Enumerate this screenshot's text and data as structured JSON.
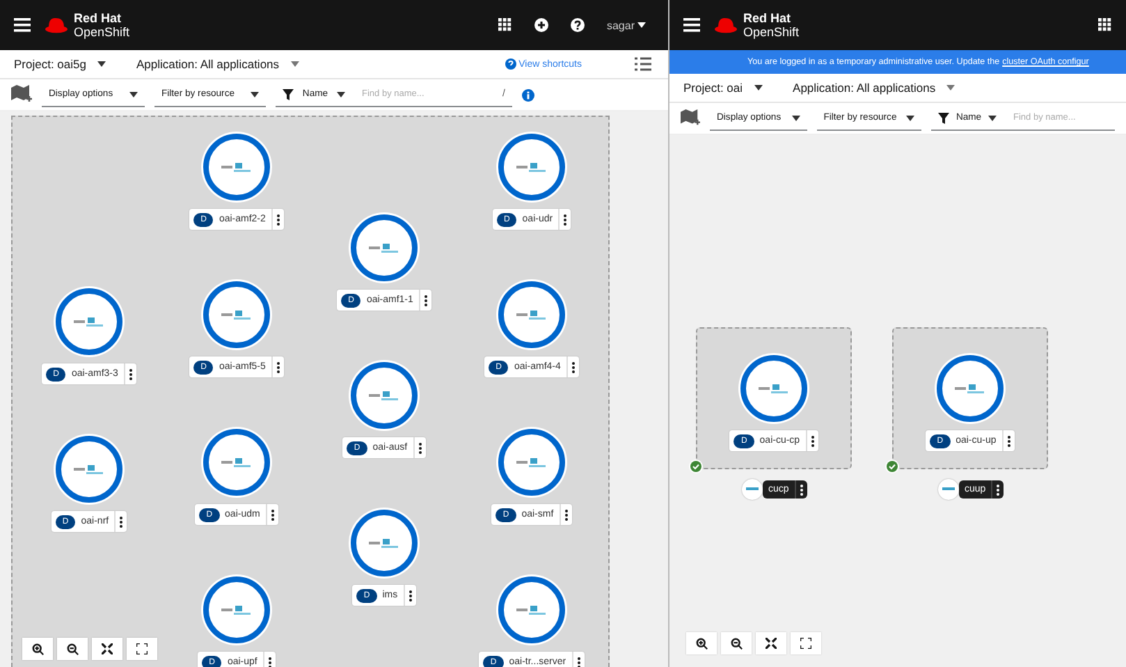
{
  "left_pane": {
    "header": {
      "brand_top": "Red Hat",
      "brand_bottom": "OpenShift",
      "user": "sagar"
    },
    "project_bar": {
      "project": "Project: oai5g",
      "application": "Application: All applications",
      "shortcuts": "View shortcuts"
    },
    "toolbar": {
      "display": "Display options",
      "filter": "Filter by resource",
      "name_filter": "Name",
      "search_placeholder": "Find by name...",
      "shortcut_key": "/"
    },
    "nodes": [
      {
        "badge": "D",
        "name": "oai-amf2-2"
      },
      {
        "badge": "D",
        "name": "oai-udr"
      },
      {
        "badge": "D",
        "name": "oai-amf1-1"
      },
      {
        "badge": "D",
        "name": "oai-amf3-3"
      },
      {
        "badge": "D",
        "name": "oai-amf5-5"
      },
      {
        "badge": "D",
        "name": "oai-amf4-4"
      },
      {
        "badge": "D",
        "name": "oai-ausf"
      },
      {
        "badge": "D",
        "name": "oai-nrf"
      },
      {
        "badge": "D",
        "name": "oai-udm"
      },
      {
        "badge": "D",
        "name": "oai-smf"
      },
      {
        "badge": "D",
        "name": "ims"
      },
      {
        "badge": "D",
        "name": "oai-upf"
      },
      {
        "badge": "D",
        "name": "oai-tr...server"
      }
    ]
  },
  "right_pane": {
    "header": {
      "brand_top": "Red Hat",
      "brand_bottom": "OpenShift"
    },
    "banner": {
      "text": "You are logged in as a temporary administrative user. Update the",
      "link": "cluster OAuth configur"
    },
    "project_bar": {
      "project": "Project: oai",
      "application": "Application: All applications"
    },
    "toolbar": {
      "display": "Display options",
      "filter": "Filter by resource",
      "name_filter": "Name",
      "search_placeholder": "Find by name..."
    },
    "groups": [
      {
        "name": "cucp",
        "ready": true,
        "node": {
          "badge": "D",
          "name": "oai-cu-cp"
        }
      },
      {
        "name": "cuup",
        "ready": true,
        "node": {
          "badge": "D",
          "name": "oai-cu-up"
        }
      }
    ]
  }
}
